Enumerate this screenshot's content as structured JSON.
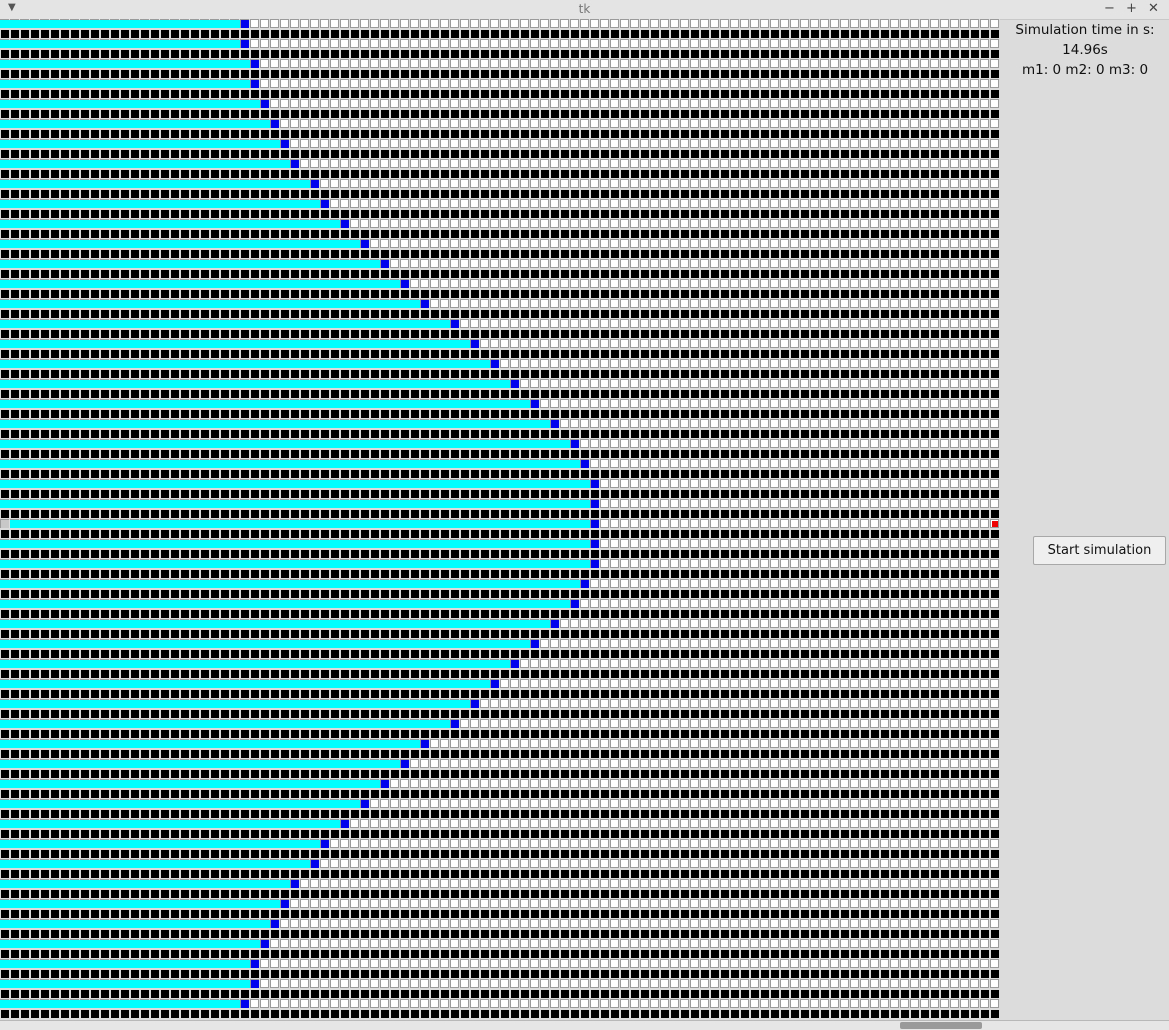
{
  "window": {
    "title": "tk"
  },
  "info": {
    "sim_time_label": "Simulation time in s:",
    "sim_time_value": "14.96s",
    "counters": "m1: 0 m2: 0 m3: 0"
  },
  "controls": {
    "start_label": "Start simulation"
  },
  "simulation": {
    "columns": 100,
    "rows": 50,
    "special_lane": 25,
    "lane_heads": [
      24,
      24,
      25,
      25,
      26,
      27,
      28,
      29,
      31,
      32,
      34,
      36,
      38,
      40,
      42,
      45,
      47,
      49,
      51,
      53,
      55,
      57,
      58,
      59,
      59,
      59,
      59,
      59,
      58,
      57,
      55,
      53,
      51,
      49,
      47,
      45,
      42,
      40,
      38,
      36,
      34,
      32,
      31,
      29,
      28,
      27,
      26,
      25,
      25,
      24
    ],
    "colors": {
      "background": "#dcdcdc",
      "road_cell": "#000000",
      "empty_cell": "#ffffff",
      "occupied_cell": "#00ffff",
      "head_cell": "#0000ee",
      "end_marker": "#ee0000",
      "start_marker": "#c8c8c8"
    }
  }
}
